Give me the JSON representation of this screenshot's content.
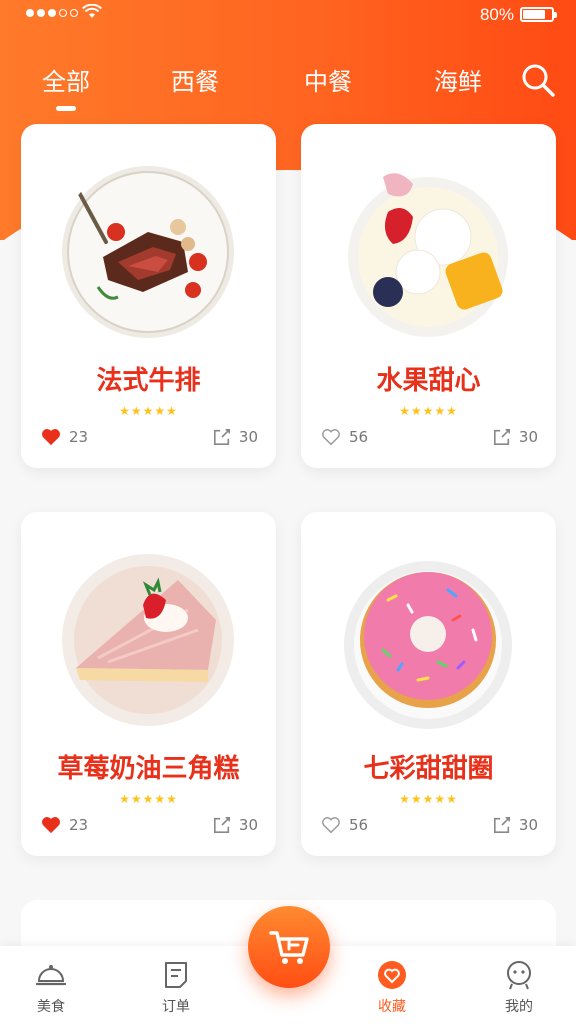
{
  "status_bar": {
    "battery": "80%"
  },
  "tabs": [
    {
      "label": "全部",
      "active": true
    },
    {
      "label": "西餐"
    },
    {
      "label": "中餐"
    },
    {
      "label": "海鲜"
    }
  ],
  "cards": [
    {
      "title": "法式牛排",
      "rating": 5,
      "likes": "23",
      "liked": true,
      "shares": "30",
      "image_icon": "steak-plate-image"
    },
    {
      "title": "水果甜心",
      "rating": 5,
      "likes": "56",
      "liked": false,
      "shares": "30",
      "image_icon": "fruit-dessert-image"
    },
    {
      "title": "草莓奶油三角糕",
      "rating": 5,
      "likes": "23",
      "liked": true,
      "shares": "30",
      "image_icon": "strawberry-cake-image"
    },
    {
      "title": "七彩甜甜圈",
      "rating": 5,
      "likes": "56",
      "liked": false,
      "shares": "30",
      "image_icon": "donut-image"
    }
  ],
  "bottom_nav": [
    {
      "label": "美食",
      "icon": "cloche-icon"
    },
    {
      "label": "订单",
      "icon": "order-icon"
    },
    {
      "label": "收藏",
      "icon": "favorite-icon",
      "active": true
    },
    {
      "label": "我的",
      "icon": "profile-icon"
    }
  ],
  "colors": {
    "accent": "#ff5a1f",
    "title_red": "#e8301a",
    "star": "#ffc21a"
  }
}
